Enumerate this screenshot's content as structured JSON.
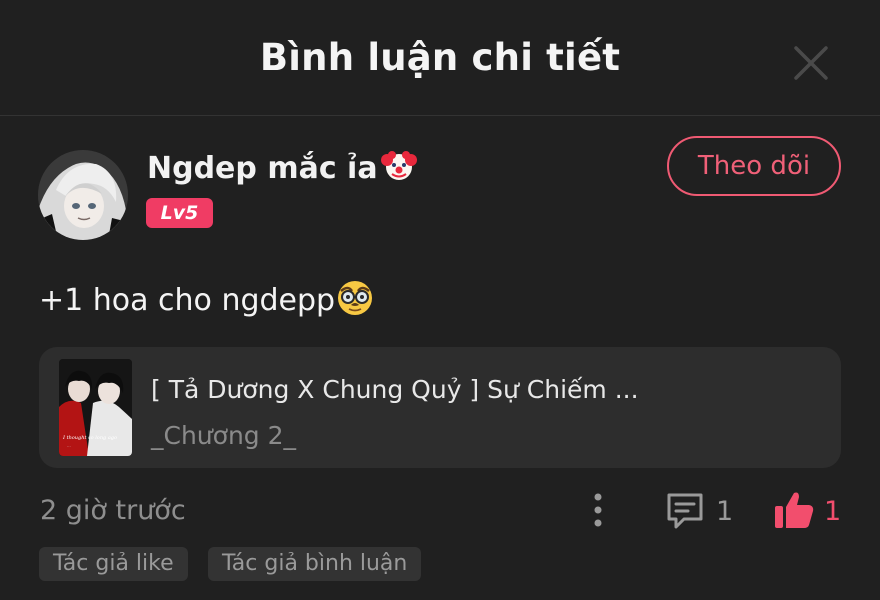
{
  "header": {
    "title": "Bình luận chi tiết",
    "close_icon": "close-icon"
  },
  "comment": {
    "user_name": "Ngdep mắc ỉa",
    "user_emoji": "clown-face-emoji",
    "level": "Lv5",
    "follow_label": "Theo dõi",
    "text": "+1 hoa cho ngdepp",
    "text_emoji": "disguised-face-emoji",
    "time": "2 giờ trước",
    "reply_count": "1",
    "like_count": "1",
    "tags": [
      "Tác giả like",
      "Tác giả bình luận"
    ]
  },
  "story": {
    "title": "[ Tả Dương X Chung Quỷ ] Sự Chiếm ...",
    "chapter": "_Chương 2_"
  },
  "colors": {
    "background": "#202020",
    "accent": "#f03c64",
    "card": "#2d2d2d",
    "muted_text": "#8e8e8e"
  }
}
